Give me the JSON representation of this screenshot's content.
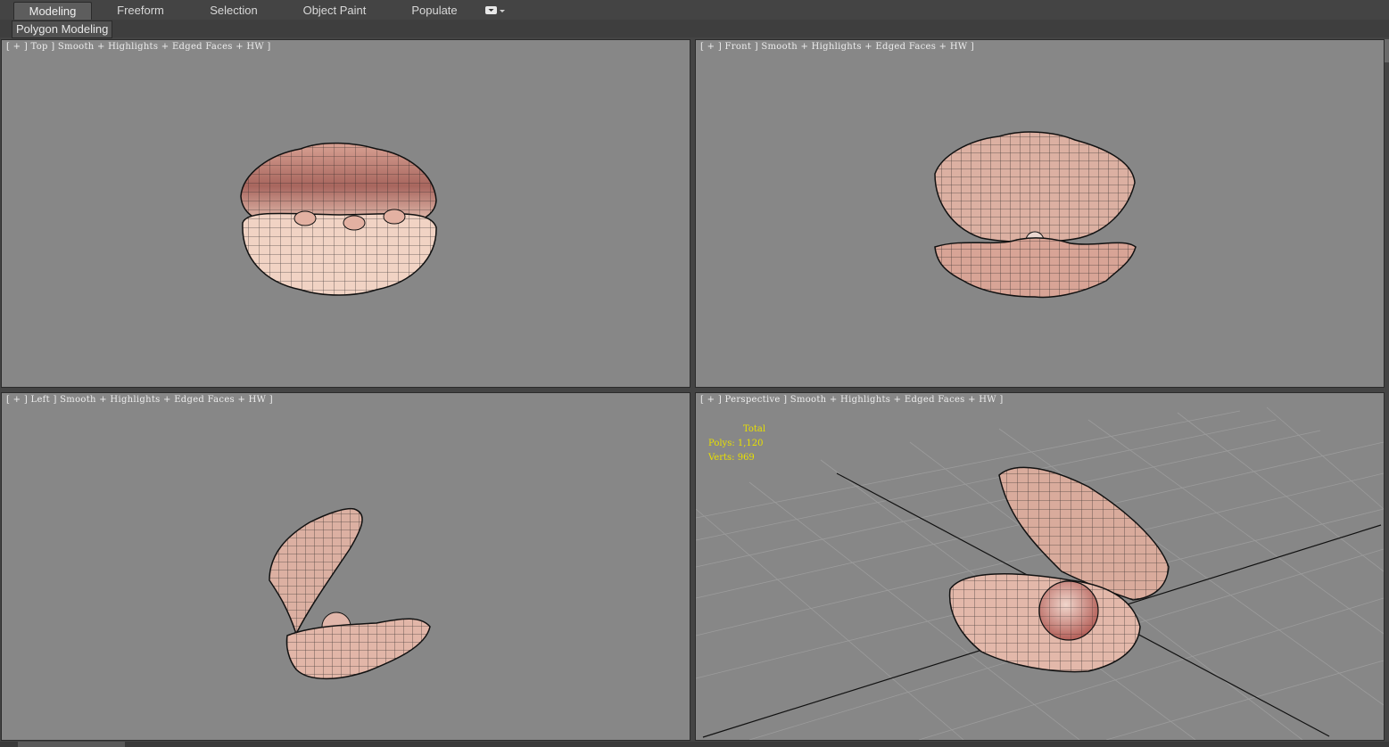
{
  "ribbon": {
    "tabs": [
      {
        "label": "Modeling",
        "active": true
      },
      {
        "label": "Freeform",
        "active": false
      },
      {
        "label": "Selection",
        "active": false
      },
      {
        "label": "Object Paint",
        "active": false
      },
      {
        "label": "Populate",
        "active": false
      }
    ],
    "dropdown_icon": "chevron-down-icon",
    "panel_label": "Polygon Modeling"
  },
  "viewports": {
    "top": {
      "label": "[ + ] Top ] Smooth + Highlights + Edged Faces + HW ]"
    },
    "front": {
      "label": "[ + ] Front ] Smooth + Highlights + Edged Faces + HW ]"
    },
    "left": {
      "label": "[ + ] Left ] Smooth + Highlights + Edged Faces + HW ]"
    },
    "perspective": {
      "label": "[ + ] Perspective ] Smooth + Highlights + Edged Faces + HW ]",
      "stats": {
        "header": "Total",
        "polys": "Polys: 1,120",
        "verts": "Verts: 969"
      }
    }
  },
  "colors": {
    "viewport_bg": "#878787",
    "shell_fill": "#e2b7a8",
    "shell_shadow": "#b9786e",
    "wire": "#1e1e1e",
    "stats_text": "#e8e000",
    "ui_bg": "#444444"
  }
}
